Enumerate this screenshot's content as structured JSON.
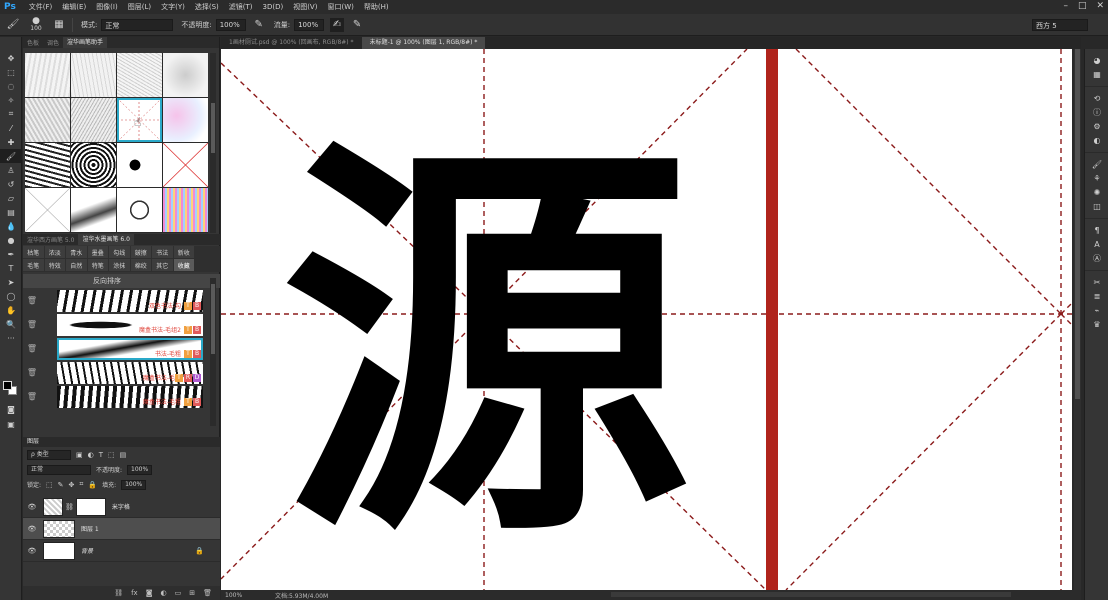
{
  "menu": {
    "logo": "Ps",
    "items": [
      "文件(F)",
      "编辑(E)",
      "图像(I)",
      "图层(L)",
      "文字(Y)",
      "选择(S)",
      "滤镜(T)",
      "3D(D)",
      "视图(V)",
      "窗口(W)",
      "帮助(H)"
    ]
  },
  "options": {
    "brush_size": "100",
    "mode_label": "模式:",
    "mode_value": "正常",
    "opacity_label": "不透明度:",
    "opacity_value": "100%",
    "flow_label": "流量:",
    "flow_value": "100%",
    "workspace": "西方 5"
  },
  "panels": {
    "brush_tabs": [
      "色板",
      "调色",
      "渲华画笔助手"
    ],
    "plugin_tabs": [
      "渲华西方画笔 5.0",
      "渲华水墨画笔 6.0"
    ],
    "categories_row1": [
      "枯笔",
      "浓淡",
      "青水",
      "墨叠",
      "勾线",
      "皴擦",
      "书法",
      "新收"
    ],
    "categories_row2": [
      "毛笔",
      "特效",
      "自然",
      "特笔",
      "涂抹",
      "棉绞",
      "其它",
      "收藏"
    ],
    "reverse_sort": "反向排序",
    "presets": [
      {
        "name": "双色书法-勾",
        "badges": [
          "T",
          "B"
        ]
      },
      {
        "name": "魔盒书法-毛组2",
        "badges": [
          "T",
          "B"
        ]
      },
      {
        "name": "书法-毛粗",
        "badges": [
          "T",
          "B"
        ]
      },
      {
        "name": "魔盒书法-毛细",
        "badges": [
          "T",
          "R",
          "D"
        ]
      },
      {
        "name": "魔盒书法-毛粗",
        "badges": [
          "T",
          "B"
        ]
      }
    ]
  },
  "layers": {
    "title": "图层",
    "kind": "ρ 类型",
    "blend": "正常",
    "opacity_label": "不透明度:",
    "opacity_value": "100%",
    "lock_label": "锁定:",
    "fill_label": "填充:",
    "fill_value": "100%",
    "items": [
      {
        "name": "米字格"
      },
      {
        "name": "图层 1"
      },
      {
        "name": "背景"
      }
    ]
  },
  "documents": {
    "tabs": [
      "1画材厕试.psd @ 100% (回画布, RGB/8#) *",
      "未标题-1 @ 100% (图层 1, RGB/8#) *"
    ]
  },
  "canvas": {
    "character": "源",
    "guide_color": "#8b1a1a",
    "bar_color": "#b0241c"
  },
  "status": {
    "zoom": "100%",
    "doc_info": "文档:5.93M/4.00M"
  },
  "icons": {
    "tools": [
      "move-icon",
      "marquee-icon",
      "lasso-icon",
      "quick-select-icon",
      "crop-icon",
      "eyedropper-icon",
      "healing-icon",
      "brush-icon",
      "stamp-icon",
      "history-brush-icon",
      "eraser-icon",
      "gradient-icon",
      "blur-icon",
      "dodge-icon",
      "pen-icon",
      "type-icon",
      "path-select-icon",
      "shape-icon",
      "hand-icon",
      "zoom-icon",
      "more-icon"
    ]
  }
}
